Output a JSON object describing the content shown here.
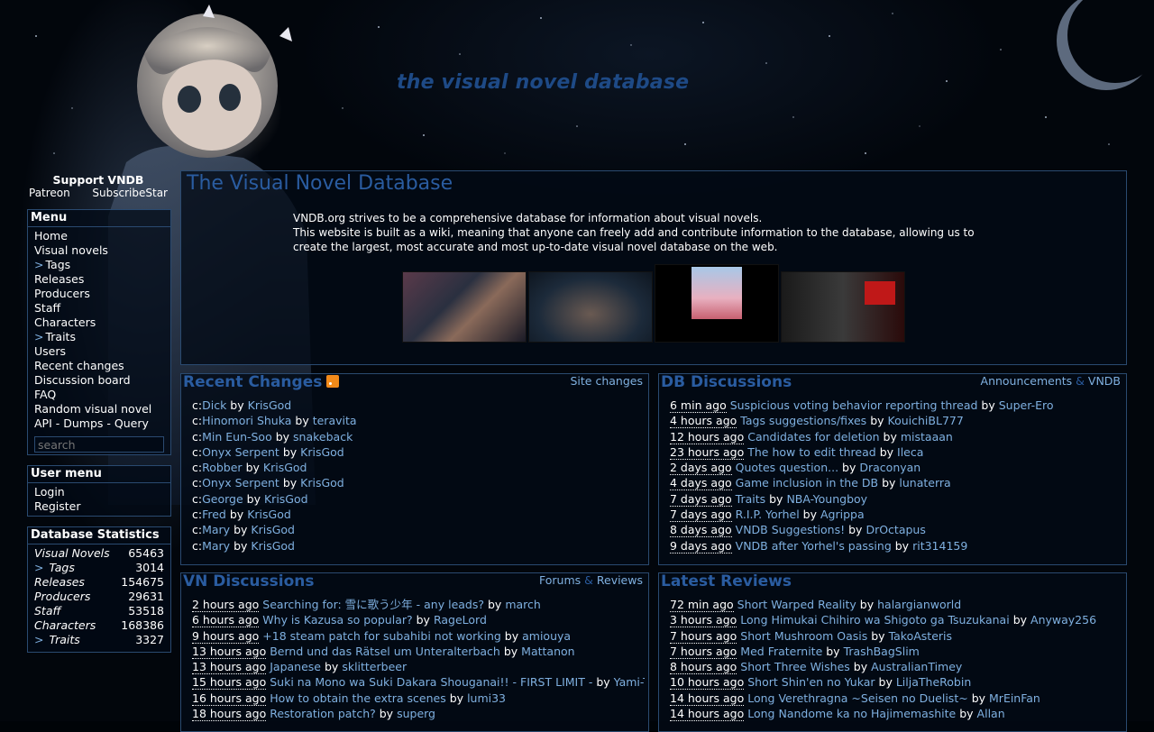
{
  "site": {
    "header_title": "the visual novel database"
  },
  "support": {
    "title": "Support VNDB",
    "patreon": "Patreon",
    "subscribestar": "SubscribeStar"
  },
  "menu": {
    "title": "Menu",
    "items": [
      "Home",
      "Visual novels",
      "Tags",
      "Releases",
      "Producers",
      "Staff",
      "Characters",
      "Traits",
      "Users",
      "Recent changes",
      "Discussion board",
      "FAQ",
      "Random visual novel",
      "API - Dumps - Query"
    ],
    "search_placeholder": "search"
  },
  "usermenu": {
    "title": "User menu",
    "login": "Login",
    "register": "Register"
  },
  "stats": {
    "title": "Database Statistics",
    "rows": [
      {
        "label": "Visual Novels",
        "value": "65463"
      },
      {
        "label": "Tags",
        "value": "3014"
      },
      {
        "label": "Releases",
        "value": "154675"
      },
      {
        "label": "Producers",
        "value": "29631"
      },
      {
        "label": "Staff",
        "value": "53518"
      },
      {
        "label": "Characters",
        "value": "168386"
      },
      {
        "label": "Traits",
        "value": "3327"
      }
    ]
  },
  "main": {
    "title": "The Visual Novel Database",
    "intro1": "VNDB.org strives to be a comprehensive database for information about visual novels.",
    "intro2": "This website is built as a wiki, meaning that anyone can freely add and contribute information to the database, allowing us to create the largest, most accurate and most up-to-date visual novel database on the web."
  },
  "recent_changes": {
    "title": "Recent Changes",
    "link": "Site changes",
    "items": [
      {
        "prefix": "c:",
        "name": "Dick",
        "user": "KrisGod"
      },
      {
        "prefix": "c:",
        "name": "Hinomori Shuka",
        "user": "teravita"
      },
      {
        "prefix": "c:",
        "name": "Min Eun-Soo",
        "user": "snakeback"
      },
      {
        "prefix": "c:",
        "name": "Onyx Serpent",
        "user": "KrisGod"
      },
      {
        "prefix": "c:",
        "name": "Robber",
        "user": "KrisGod"
      },
      {
        "prefix": "c:",
        "name": "Onyx Serpent",
        "user": "KrisGod"
      },
      {
        "prefix": "c:",
        "name": "George",
        "user": "KrisGod"
      },
      {
        "prefix": "c:",
        "name": "Fred",
        "user": "KrisGod"
      },
      {
        "prefix": "c:",
        "name": "Mary",
        "user": "KrisGod"
      },
      {
        "prefix": "c:",
        "name": "Mary",
        "user": "KrisGod"
      }
    ]
  },
  "db_discussions": {
    "title": "DB Discussions",
    "link1": "Announcements",
    "amp": "&",
    "link2": "VNDB",
    "items": [
      {
        "time": "6 min ago",
        "topic": "Suspicious voting behavior reporting thread",
        "user": "Super-Ero"
      },
      {
        "time": "4 hours ago",
        "topic": "Tags suggestions/fixes",
        "user": "KouichiBL777"
      },
      {
        "time": "12 hours ago",
        "topic": "Candidates for deletion",
        "user": "mistaaan"
      },
      {
        "time": "23 hours ago",
        "topic": "The how to edit thread",
        "user": "Ileca"
      },
      {
        "time": "2 days ago",
        "topic": "Quotes question...",
        "user": "Draconyan"
      },
      {
        "time": "4 days ago",
        "topic": "Game inclusion in the DB",
        "user": "lunaterra"
      },
      {
        "time": "7 days ago",
        "topic": "Traits",
        "user": "NBA-Youngboy"
      },
      {
        "time": "7 days ago",
        "topic": "R.I.P. Yorhel",
        "user": "Agrippa"
      },
      {
        "time": "8 days ago",
        "topic": "VNDB Suggestions!",
        "user": "DrOctapus"
      },
      {
        "time": "9 days ago",
        "topic": "VNDB after Yorhel's passing",
        "user": "rit314159"
      }
    ]
  },
  "vn_discussions": {
    "title": "VN Discussions",
    "link1": "Forums",
    "amp": "&",
    "link2": "Reviews",
    "items": [
      {
        "time": "2 hours ago",
        "topic": "Searching for: 雪に歌う少年 - any leads?",
        "user": "march"
      },
      {
        "time": "6 hours ago",
        "topic": "Why is Kazusa so popular?",
        "user": "RageLord"
      },
      {
        "time": "9 hours ago",
        "topic": "+18 steam patch for subahibi not working",
        "user": "amiouya"
      },
      {
        "time": "13 hours ago",
        "topic": "Bernd und das Rätsel um Unteralterbach",
        "user": "Mattanon"
      },
      {
        "time": "13 hours ago",
        "topic": "Japanese",
        "user": "sklitterbeer"
      },
      {
        "time": "15 hours ago",
        "topic": "Suki na Mono wa Suki Dakara Shouganai!! - FIRST LIMIT -",
        "user": "Yami-Tan"
      },
      {
        "time": "16 hours ago",
        "topic": "How to obtain the extra scenes",
        "user": "lumi33"
      },
      {
        "time": "18 hours ago",
        "topic": "Restoration patch?",
        "user": "superg"
      }
    ]
  },
  "latest_reviews": {
    "title": "Latest Reviews",
    "items": [
      {
        "time": "72 min ago",
        "kind": "Short",
        "vn": "Warped Reality",
        "user": "halargianworld"
      },
      {
        "time": "3 hours ago",
        "kind": "Long",
        "vn": "Himukai Chihiro wa Shigoto ga Tsuzukanai",
        "user": "Anyway256"
      },
      {
        "time": "7 hours ago",
        "kind": "Short",
        "vn": "Mushroom Oasis",
        "user": "TakoAsteris"
      },
      {
        "time": "7 hours ago",
        "kind": "Med",
        "vn": "Fraternite",
        "user": "TrashBagSlim"
      },
      {
        "time": "8 hours ago",
        "kind": "Short",
        "vn": "Three Wishes",
        "user": "AustralianTimey"
      },
      {
        "time": "10 hours ago",
        "kind": "Short",
        "vn": "Shin'en no Yukar",
        "user": "LiljaTheRobin"
      },
      {
        "time": "14 hours ago",
        "kind": "Long",
        "vn": "Verethragna ~Seisen no Duelist~",
        "user": "MrEinFan"
      },
      {
        "time": "14 hours ago",
        "kind": "Long",
        "vn": "Nandome ka no Hajimemashite",
        "user": "Allan"
      }
    ]
  },
  "by_word": "by"
}
